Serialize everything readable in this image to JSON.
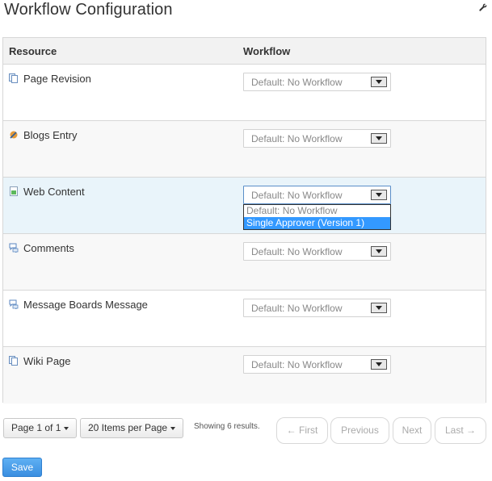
{
  "page": {
    "title": "Workflow Configuration"
  },
  "table": {
    "headers": {
      "resource": "Resource",
      "workflow": "Workflow"
    },
    "rows": [
      {
        "name": "Page Revision",
        "icon": "page-revision-icon",
        "workflow": "Default: No Workflow"
      },
      {
        "name": "Blogs Entry",
        "icon": "blogs-entry-icon",
        "workflow": "Default: No Workflow"
      },
      {
        "name": "Web Content",
        "icon": "web-content-icon",
        "workflow": "Default: No Workflow"
      },
      {
        "name": "Comments",
        "icon": "comments-icon",
        "workflow": "Default: No Workflow"
      },
      {
        "name": "Message Boards Message",
        "icon": "message-boards-icon",
        "workflow": "Default: No Workflow"
      },
      {
        "name": "Wiki Page",
        "icon": "wiki-page-icon",
        "workflow": "Default: No Workflow"
      }
    ]
  },
  "dropdown": {
    "options": [
      "Default: No Workflow",
      "Single Approver (Version 1)"
    ],
    "highlighted_index": 1
  },
  "pagination": {
    "page_label": "Page 1 of 1",
    "items_per_page_label": "20 Items per Page",
    "showing_text": "Showing 6 results.",
    "first": "← First",
    "previous": "Previous",
    "next": "Next",
    "last": "Last →"
  },
  "actions": {
    "save": "Save"
  },
  "colors": {
    "accent": "#3399ff",
    "save": "#4a9fe8",
    "hover_row": "#e9f4fa"
  }
}
